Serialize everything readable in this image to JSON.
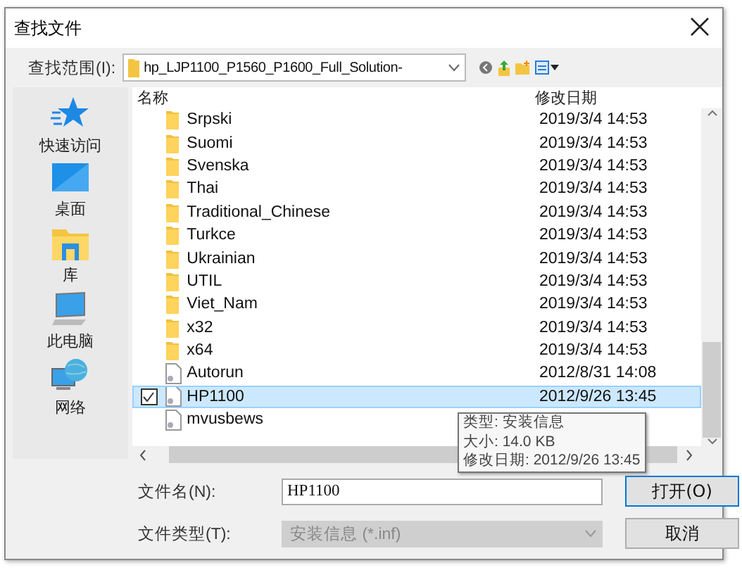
{
  "window": {
    "title": "查找文件"
  },
  "location": {
    "label": "查找范围(I):",
    "value": "hp_LJP1100_P1560_P1600_Full_Solution-"
  },
  "places": [
    {
      "label": "快速访问",
      "kind": "star"
    },
    {
      "label": "桌面",
      "kind": "desktop"
    },
    {
      "label": "库",
      "kind": "library"
    },
    {
      "label": "此电脑",
      "kind": "computer"
    },
    {
      "label": "网络",
      "kind": "network"
    }
  ],
  "columns": [
    "名称",
    "修改日期"
  ],
  "files": [
    {
      "name": "Srpski",
      "date": "2019/3/4 14:53",
      "kind": "folder",
      "selected": false
    },
    {
      "name": "Suomi",
      "date": "2019/3/4 14:53",
      "kind": "folder",
      "selected": false
    },
    {
      "name": "Svenska",
      "date": "2019/3/4 14:53",
      "kind": "folder",
      "selected": false
    },
    {
      "name": "Thai",
      "date": "2019/3/4 14:53",
      "kind": "folder",
      "selected": false
    },
    {
      "name": "Traditional_Chinese",
      "date": "2019/3/4 14:53",
      "kind": "folder",
      "selected": false
    },
    {
      "name": "Turkce",
      "date": "2019/3/4 14:53",
      "kind": "folder",
      "selected": false
    },
    {
      "name": "Ukrainian",
      "date": "2019/3/4 14:53",
      "kind": "folder",
      "selected": false
    },
    {
      "name": "UTIL",
      "date": "2019/3/4 14:53",
      "kind": "folder",
      "selected": false
    },
    {
      "name": "Viet_Nam",
      "date": "2019/3/4 14:53",
      "kind": "folder",
      "selected": false
    },
    {
      "name": "x32",
      "date": "2019/3/4 14:53",
      "kind": "folder",
      "selected": false
    },
    {
      "name": "x64",
      "date": "2019/3/4 14:53",
      "kind": "folder",
      "selected": false
    },
    {
      "name": "Autorun",
      "date": "2012/8/31 14:08",
      "kind": "file",
      "selected": false
    },
    {
      "name": "HP1100",
      "date": "2012/9/26 13:45",
      "kind": "file",
      "selected": true
    },
    {
      "name": "mvusbews",
      "kind": "file",
      "selected": false
    }
  ],
  "tooltip": [
    "类型: 安装信息",
    "大小: 14.0 KB",
    "修改日期: 2012/9/26 13:45"
  ],
  "filename": {
    "label": "文件名(N):",
    "value": "HP1100"
  },
  "filetype": {
    "label": "文件类型(T):",
    "value": "安装信息 (*.inf)",
    "disabled": true
  },
  "buttons": [
    "打开(O)",
    "取消"
  ]
}
